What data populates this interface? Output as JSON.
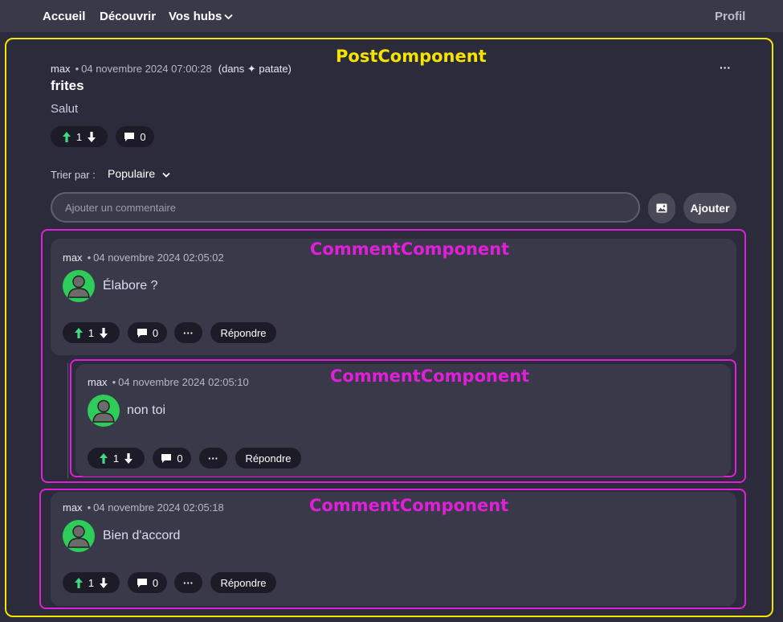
{
  "nav": {
    "home": "Accueil",
    "discover": "Découvrir",
    "hubs": "Vos hubs",
    "profile": "Profil"
  },
  "annotations": {
    "post": "PostComponent",
    "comment": "CommentComponent"
  },
  "post": {
    "author": "max",
    "date": "04 novembre 2024 07:00:28",
    "hub": "(dans ✦ patate)",
    "title": "frites",
    "body": "Salut",
    "votes": "1",
    "comments": "0",
    "menu": "···"
  },
  "sort": {
    "label": "Trier par :",
    "value": "Populaire"
  },
  "new_comment": {
    "placeholder": "Ajouter un commentaire",
    "add_label": "Ajouter"
  },
  "comments": [
    {
      "author": "max",
      "date": "04 novembre 2024 02:05:02",
      "text": "Élabore ?",
      "votes": "1",
      "replies": "0",
      "more": "···",
      "reply_label": "Répondre"
    },
    {
      "author": "max",
      "date": "04 novembre 2024 02:05:10",
      "text": "non toi",
      "votes": "1",
      "replies": "0",
      "more": "···",
      "reply_label": "Répondre"
    },
    {
      "author": "max",
      "date": "04 novembre 2024 02:05:18",
      "text": "Bien d'accord",
      "votes": "1",
      "replies": "0",
      "more": "···",
      "reply_label": "Répondre"
    }
  ],
  "colors": {
    "background": "#2c2b3b",
    "topbar": "#3a3949",
    "card": "#3a3949",
    "pill": "#1c1b27",
    "upvote": "#3ddc84",
    "avatar": "#2ecc5a",
    "annotation_post": "#f5e400",
    "annotation_comment": "#e020d8"
  },
  "icons": {
    "upvote": "arrow-up-icon",
    "downvote": "arrow-down-icon",
    "comments": "speech-bubble-icon",
    "more": "ellipsis-icon",
    "image": "image-icon",
    "hubs_dropdown": "chevron-down-icon",
    "avatar": "user-avatar-icon"
  }
}
